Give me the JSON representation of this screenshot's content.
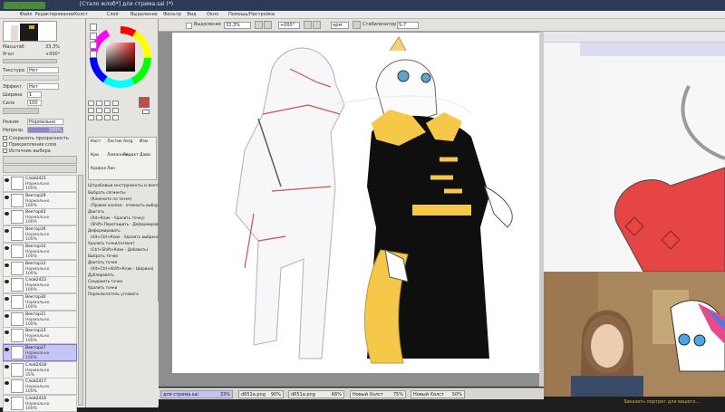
{
  "window": {
    "title": "[Стало жлоб*] для стрима.sai (*)"
  },
  "menu": [
    "Файл",
    "Редактирование",
    "Холст",
    "Слой",
    "Выделение",
    "Фильтр",
    "Вид",
    "Окно",
    "Помощь/Настройки"
  ],
  "toolbar": {
    "selection_label": "Выделение",
    "zoom_value": "33,3%",
    "angle_value": "+000°",
    "mode_value": "нрм",
    "stabilizer_label": "Стабилизатор",
    "stabilizer_value": "S-7"
  },
  "navigator": {
    "zoom_label": "Масштаб",
    "zoom_value": "33,3%",
    "angle_label": "Угол",
    "angle_value": "+000°"
  },
  "layer_props": {
    "texture_label": "Текстура",
    "texture_value": "Нет",
    "effect_label": "Эффект",
    "effect_value": "Нет",
    "width_label": "Ширина",
    "width_value": "1",
    "strength_label": "Сила",
    "strength_value": "100",
    "blend_label": "Режим",
    "blend_value": "Нормально",
    "opacity_label": "Непрозр.",
    "opacity_value": "100%",
    "protect_label": "Сохранять прозрачность",
    "clip_label": "Прикрепление слоя",
    "source_label": "Источник выбора"
  },
  "layers": [
    {
      "name": "Слой2421",
      "mode": "Нормально",
      "opacity": "100%",
      "selected": false
    },
    {
      "name": "Вектор29",
      "mode": "Нормально",
      "opacity": "100%",
      "selected": false
    },
    {
      "name": "Вектор43",
      "mode": "Нормально",
      "opacity": "100%",
      "selected": false
    },
    {
      "name": "Вектор16",
      "mode": "Нормально",
      "opacity": "100%",
      "selected": false
    },
    {
      "name": "Вектор14",
      "mode": "Нормально",
      "opacity": "100%",
      "selected": false
    },
    {
      "name": "Вектор12",
      "mode": "Нормально",
      "opacity": "100%",
      "selected": false
    },
    {
      "name": "Слой2422",
      "mode": "Нормально",
      "opacity": "100%",
      "selected": false
    },
    {
      "name": "Вектор30",
      "mode": "Нормально",
      "opacity": "100%",
      "selected": false
    },
    {
      "name": "Вектор31",
      "mode": "Нормально",
      "opacity": "100%",
      "selected": false
    },
    {
      "name": "Вектор33",
      "mode": "Нормально",
      "opacity": "100%",
      "selected": false
    },
    {
      "name": "Вектор27",
      "mode": "Нормально",
      "opacity": "100%",
      "selected": true
    },
    {
      "name": "Слой2418",
      "mode": "Нормально",
      "opacity": "35%",
      "selected": false
    },
    {
      "name": "Слой2417",
      "mode": "Нормально",
      "opacity": "100%",
      "selected": false
    },
    {
      "name": "Слой2416",
      "mode": "Нормально",
      "opacity": "100%",
      "selected": false
    }
  ],
  "tools": {
    "row1": [
      "Кист",
      "Ластик",
      "Aerg",
      "Изм"
    ],
    "row2": [
      "Кри",
      "Ломанная",
      "Редакт",
      "Дави"
    ],
    "row3": [
      "Кривая",
      "Лин"
    ]
  },
  "vector_help": {
    "header": "Штрабовые инструменты и векторы",
    "items": [
      "Выбрать сегменты",
      "(Кликните по точке)",
      "(Правая кнопка - отменить выбор)",
      "Двигать",
      "(Alt+Клик - Удалить точку)",
      "(Shift+Перетащить - Деформировать)",
      "Деформировать",
      "(Alt+Ctrl+Клик - Удалить выбранное)",
      "Удалить точки/сегмент",
      "(Ctrl+Shift+Клик - Добавить)",
      "Выбрать точки",
      "Двигать точки",
      "(Alt+Ctrl+Shift+Клик - Ширина)",
      "Дублировать",
      "Соединить точки",
      "Удалить точки",
      "Переключатель углового"
    ]
  },
  "tabs": [
    {
      "name": "для стрима.sai",
      "zoom": "33%"
    },
    {
      "name": "d651a.png",
      "zoom": "90%"
    },
    {
      "name": "d651a.png",
      "zoom": "66%"
    },
    {
      "name": "Новый Холст",
      "zoom": "75%"
    },
    {
      "name": "Новый Холст",
      "zoom": "50%"
    }
  ],
  "colors": {
    "primary": "#c24a44",
    "secondary": "#ffffff",
    "title_bar": "#2c3a55",
    "layer_selected": "#c6c4f4"
  },
  "bottom_notice": "Заказать портрет для вашего..."
}
